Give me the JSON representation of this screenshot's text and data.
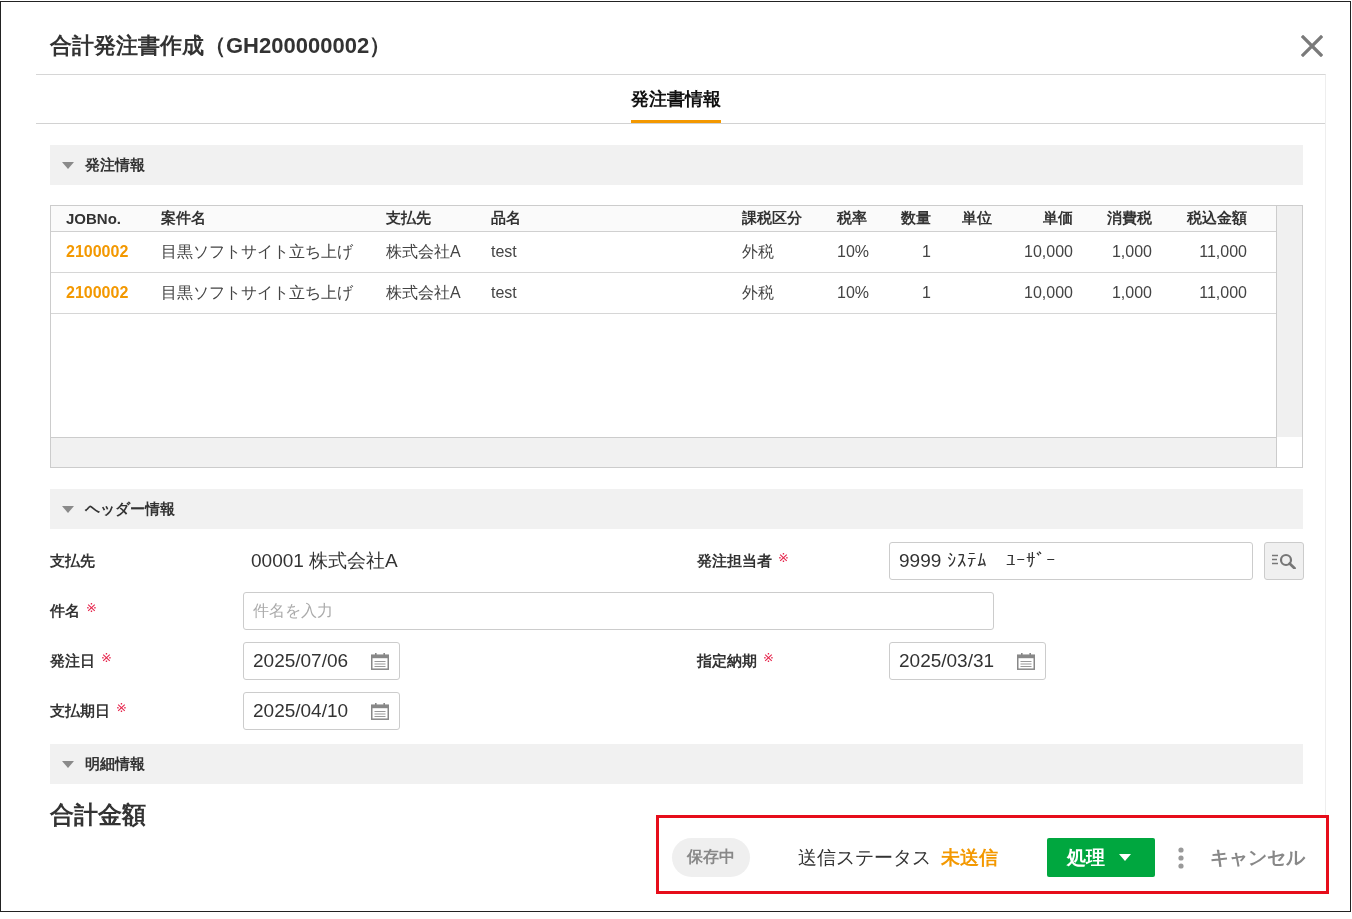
{
  "dialog": {
    "title": "合計発注書作成（GH200000002）"
  },
  "tabs": [
    {
      "label": "発注書情報",
      "selected": true
    }
  ],
  "order_section": {
    "title": "発注情報",
    "expanded": true,
    "table": {
      "columns": [
        {
          "label": "JOBNo.",
          "kind": "link",
          "cells": [
            "2100002",
            "2100002"
          ]
        },
        {
          "label": "案件名",
          "kind": "text",
          "cells": [
            "目黒ソフトサイト立ち上げ",
            "目黒ソフトサイト立ち上げ"
          ]
        },
        {
          "label": "支払先",
          "kind": "text",
          "cells": [
            "株式会社A",
            "株式会社A"
          ]
        },
        {
          "label": "品名",
          "kind": "text",
          "cells": [
            "test",
            "test"
          ]
        },
        {
          "label": "課税区分",
          "kind": "text",
          "cells": [
            "外税",
            "外税"
          ]
        },
        {
          "label": "税率",
          "kind": "text",
          "cells": [
            "10%",
            "10%"
          ]
        },
        {
          "label": "数量",
          "kind": "number",
          "cells": [
            "1",
            "1"
          ]
        },
        {
          "label": "単位",
          "kind": "text"
        },
        {
          "label": "単価",
          "kind": "number",
          "cells": [
            "10,000",
            "10,000"
          ]
        },
        {
          "label": "消費税",
          "kind": "number",
          "cells": [
            "1,000",
            "1,000"
          ]
        },
        {
          "label": "税込金額",
          "kind": "number",
          "cells": [
            "11,000",
            "11,000"
          ]
        }
      ]
    }
  },
  "header_section": {
    "title": "ヘッダー情報",
    "expanded": true,
    "rows": [
      [
        {
          "label": "支払先",
          "kind": "text",
          "value": "00001 株式会社A"
        },
        {
          "label": "発注担当者",
          "required_mark": "※",
          "kind": "lookup",
          "value": "9999 ｼｽﾃﾑ　ﾕｰｻﾞｰ"
        }
      ],
      [
        {
          "label": "件名",
          "required_mark": "※",
          "kind": "input",
          "placeholder": "件名を入力"
        }
      ],
      [
        {
          "label": "発注日",
          "required_mark": "※",
          "kind": "date",
          "value": "2025/07/06"
        },
        {
          "label": "指定納期",
          "required_mark": "※",
          "kind": "date",
          "value": "2025/03/31"
        }
      ],
      [
        {
          "label": "支払期日",
          "required_mark": "※",
          "kind": "date",
          "value": "2025/04/10"
        }
      ]
    ]
  },
  "detail_section": {
    "title": "明細情報",
    "expanded": true
  },
  "total": {
    "title": "合計金額"
  },
  "footer": {
    "highlighted": true,
    "save_state": "保存中",
    "send_status_label": "送信ステータス",
    "send_status": "未送信",
    "process_button": "処理",
    "cancel_button": "キャンセル"
  }
}
